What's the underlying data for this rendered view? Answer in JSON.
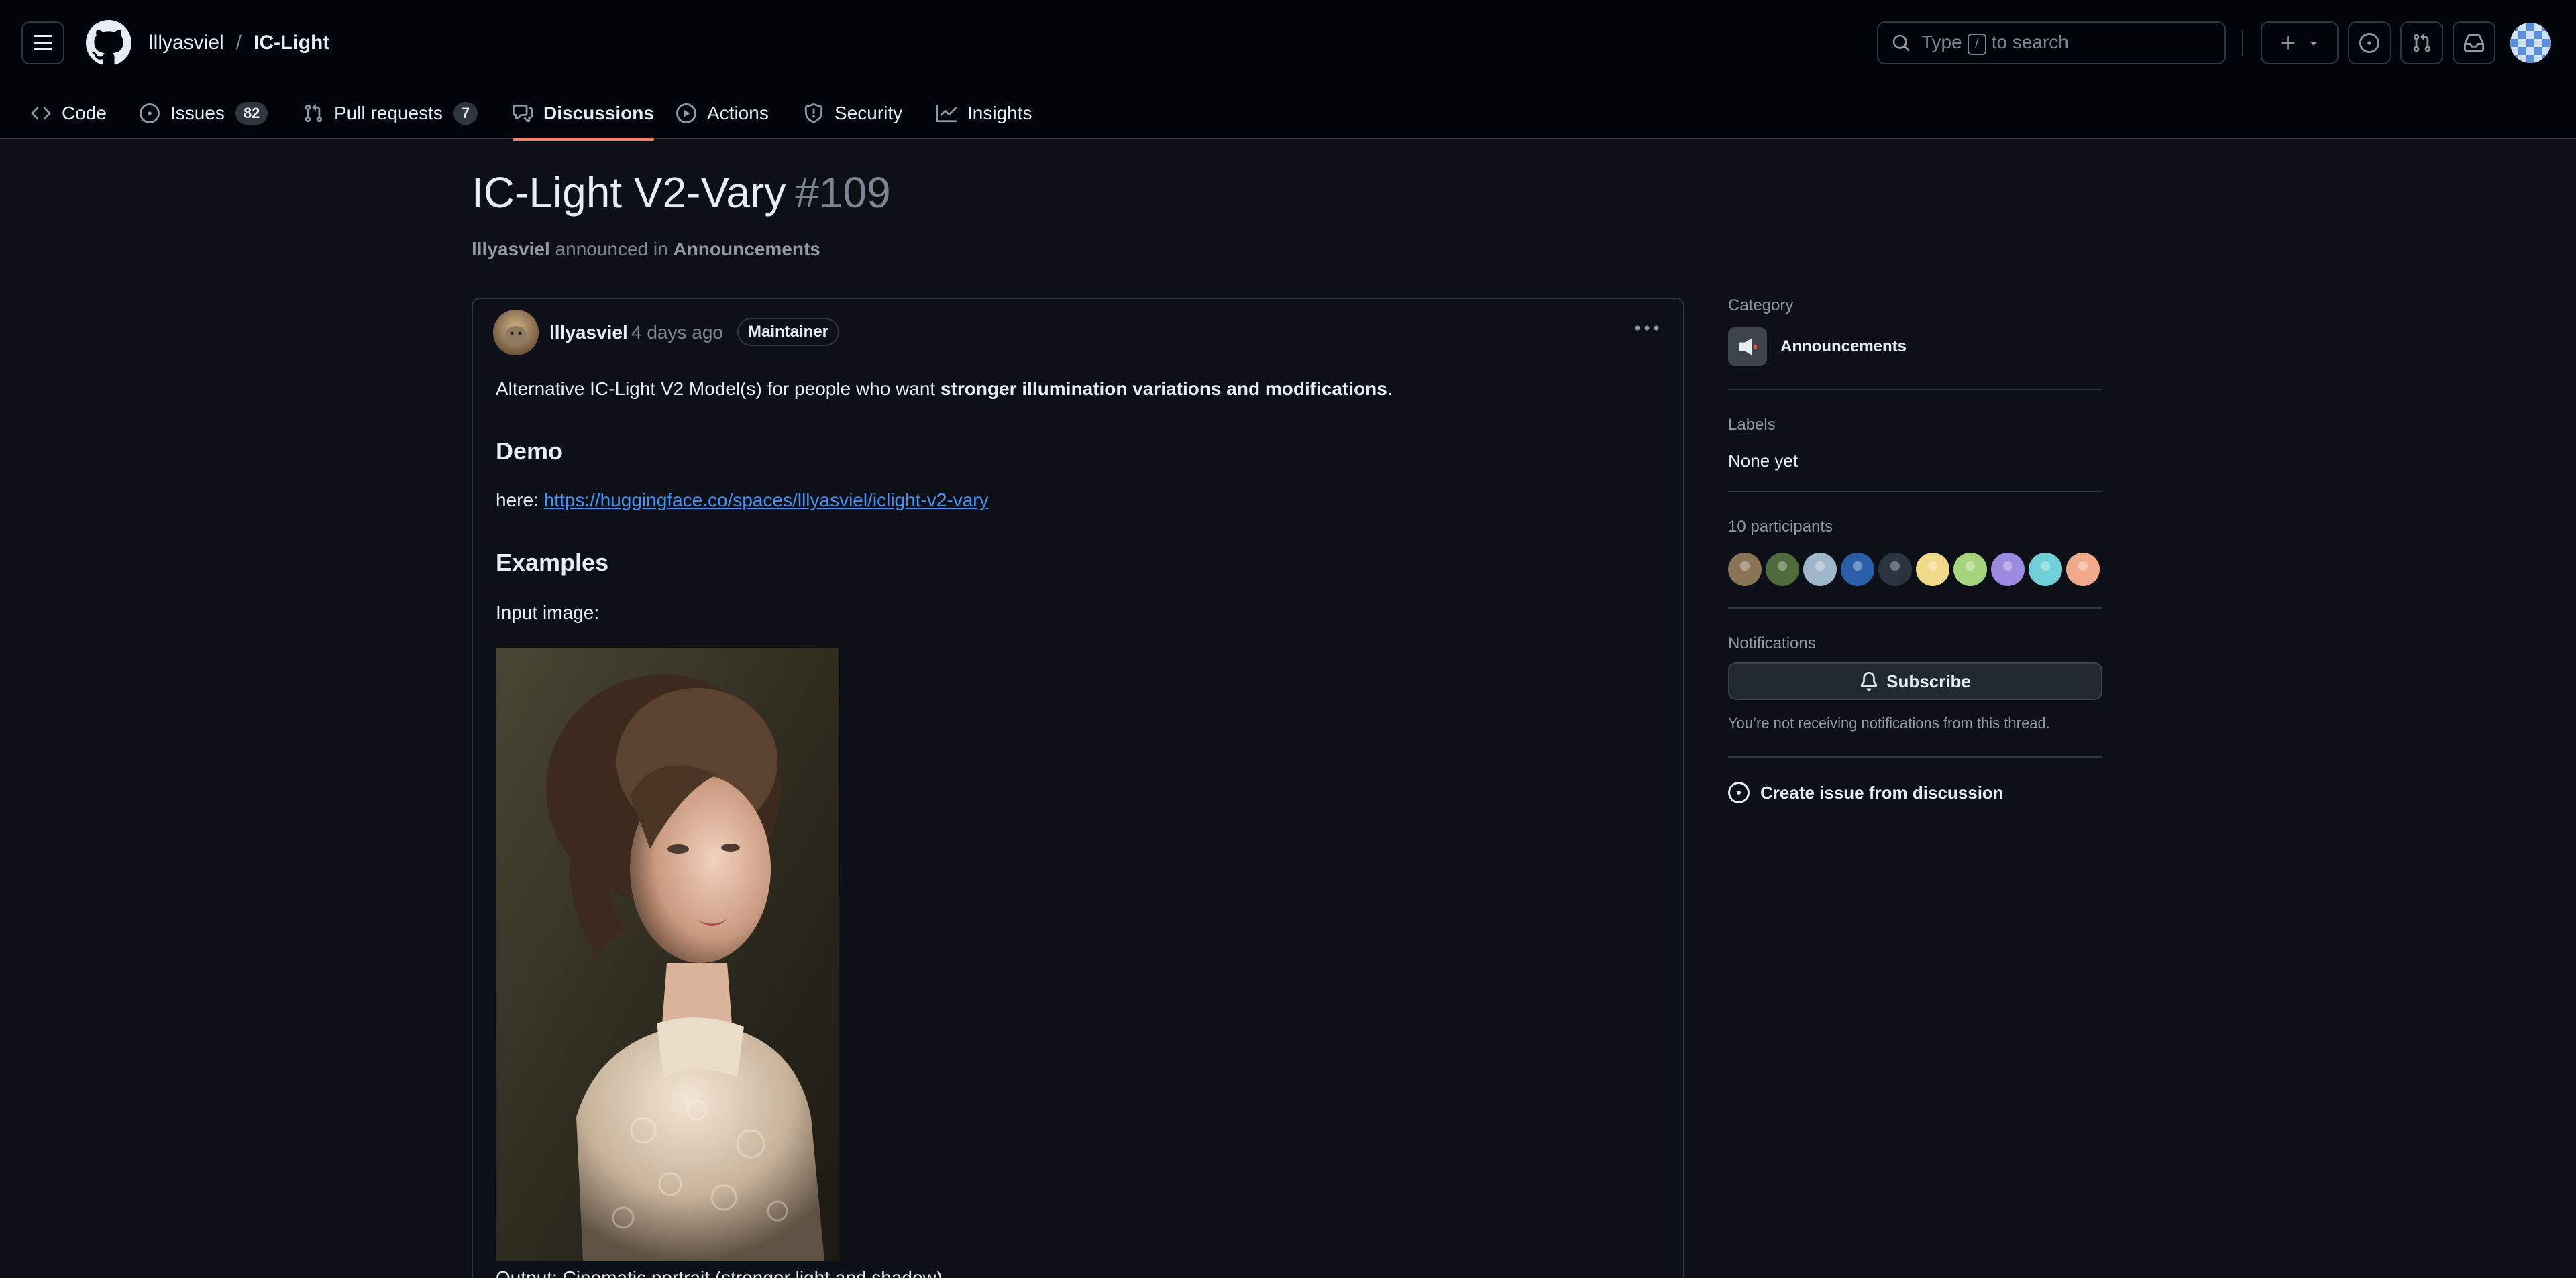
{
  "header": {
    "owner": "lllyasviel",
    "separator": "/",
    "repo": "IC-Light",
    "search_prefix": "Type",
    "search_key": "/",
    "search_suffix": "to search"
  },
  "tabs": [
    {
      "label": "Code",
      "icon": "code-icon"
    },
    {
      "label": "Issues",
      "icon": "issue-opened-icon",
      "count": "82"
    },
    {
      "label": "Pull requests",
      "icon": "git-pull-request-icon",
      "count": "7"
    },
    {
      "label": "Discussions",
      "icon": "comment-discussion-icon",
      "active": true
    },
    {
      "label": "Actions",
      "icon": "play-icon"
    },
    {
      "label": "Security",
      "icon": "shield-icon"
    },
    {
      "label": "Insights",
      "icon": "graph-icon"
    }
  ],
  "discussion": {
    "title": "IC-Light V2-Vary",
    "number": "#109",
    "author": "lllyasviel",
    "verb": "announced in",
    "category": "Announcements"
  },
  "post": {
    "author": "lllyasviel",
    "time": "4 days ago",
    "badge": "Maintainer",
    "intro_prefix": "Alternative IC-Light V2 Model(s) for people who want ",
    "intro_bold": "stronger illumination variations and modifications",
    "intro_suffix": ".",
    "demo_heading": "Demo",
    "demo_prefix": "here: ",
    "demo_link": "https://huggingface.co/spaces/lllyasviel/iclight-v2-vary",
    "examples_heading": "Examples",
    "input_label": "Input image:",
    "next_line_partial": "Output: Cinematic portrait (stronger light and shadow)"
  },
  "sidebar": {
    "category_heading": "Category",
    "category_value": "Announcements",
    "labels_heading": "Labels",
    "labels_value": "None yet",
    "participants_heading": "10 participants",
    "participants": [
      {
        "color": "#8a7456"
      },
      {
        "color": "#4f6a3b"
      },
      {
        "color": "#9fb5c8"
      },
      {
        "color": "#2b5ea8"
      },
      {
        "color": "#2c3340"
      },
      {
        "color": "#f1d98a"
      },
      {
        "color": "#a6d47d"
      },
      {
        "color": "#9a8ae0"
      },
      {
        "color": "#6fd0d8"
      },
      {
        "color": "#f0a98a"
      }
    ],
    "notifications_heading": "Notifications",
    "subscribe_label": "Subscribe",
    "notification_note": "You’re not receiving notifications from this thread.",
    "create_issue_label": "Create issue from discussion"
  },
  "colors": {
    "background": "#0d1117",
    "header": "#010409",
    "border": "#30363d",
    "link": "#4493f8",
    "active_tab_underline": "#f78166"
  }
}
